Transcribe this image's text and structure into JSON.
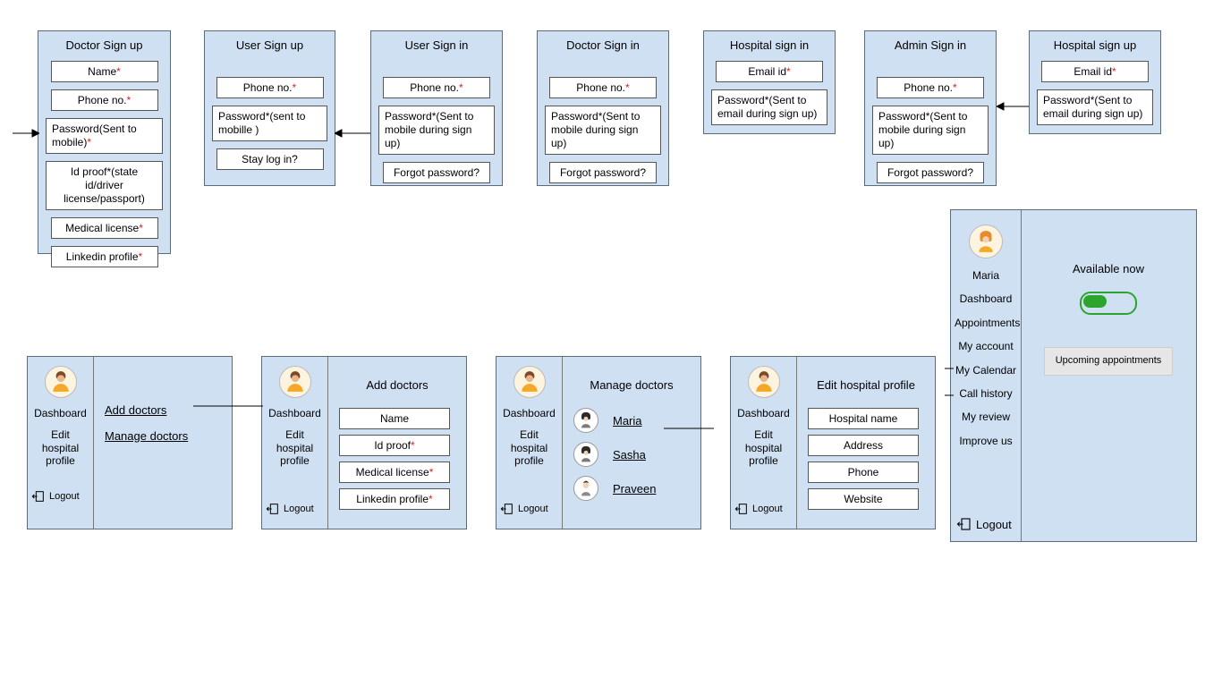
{
  "cards": {
    "doctor_signup": {
      "title": "Doctor Sign up",
      "name": "Name",
      "phone": "Phone no.",
      "password": "Password(Sent to mobile)",
      "idproof": "Id proof*(state id/driver license/passport)",
      "medlic": "Medical license",
      "linkedin": "Linkedin profile"
    },
    "user_signup": {
      "title": "User Sign up",
      "phone": "Phone no.",
      "password": "Password*(sent to mobille )",
      "stay": "Stay log in?"
    },
    "user_signin": {
      "title": "User Sign in",
      "phone": "Phone no.",
      "password": "Password*(Sent to mobile during sign up)",
      "forgot": "Forgot password?"
    },
    "doctor_signin": {
      "title": "Doctor Sign in",
      "phone": "Phone no.",
      "password": "Password*(Sent to mobile during sign up)",
      "forgot": "Forgot password?"
    },
    "hospital_signin": {
      "title": "Hospital sign in",
      "email": "Email id",
      "password": "Password*(Sent to email during sign up)"
    },
    "admin_signin": {
      "title": "Admin Sign in",
      "phone": "Phone no.",
      "password": "Password*(Sent to mobile during sign up)",
      "forgot": "Forgot password?"
    },
    "hospital_signup": {
      "title": "Hospital sign up",
      "email": "Email id",
      "password": "Password*(Sent to email during sign up)"
    }
  },
  "dash": {
    "sidebar": {
      "dashboard": "Dashboard",
      "edit_profile": "Edit hospital profile",
      "logout": "Logout"
    },
    "home": {
      "add_doctors": "Add doctors",
      "manage_doctors": "Manage doctors"
    },
    "add": {
      "title": "Add doctors",
      "name": "Name",
      "idproof": "Id proof",
      "medlic": "Medical license",
      "linkedin": "Linkedin profile"
    },
    "manage": {
      "title": "Manage doctors",
      "d1": "Maria",
      "d2": "Sasha",
      "d3": "Praveen"
    },
    "edit": {
      "title": "Edit hospital profile",
      "f1": "Hospital name",
      "f2": "Address",
      "f3": "Phone",
      "f4": "Website"
    }
  },
  "big": {
    "user": "Maria",
    "nav": {
      "dashboard": "Dashboard",
      "appointments": "Appointments",
      "account": "My account",
      "calendar": "My Calendar",
      "callhistory": "Call history",
      "review": "My review",
      "improve": "Improve us"
    },
    "logout": "Logout",
    "available": "Available now",
    "upcoming": "Upcoming appointments"
  }
}
